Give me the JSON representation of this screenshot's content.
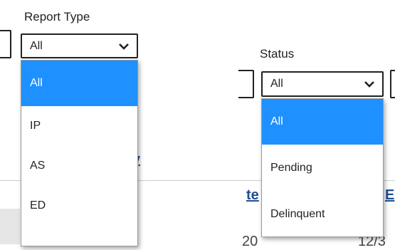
{
  "report_type": {
    "label": "Report Type",
    "selected": "All",
    "options": [
      "All",
      "IP",
      "AS",
      "ED"
    ]
  },
  "status": {
    "label": "Status",
    "selected": "All",
    "options": [
      "All",
      "Pending",
      "Delinquent"
    ]
  },
  "background": {
    "link_fragment_1": "y",
    "link_fragment_2": "te",
    "link_fragment_3": "E",
    "row_fragment_1": "20",
    "row_fragment_2": "12/3"
  },
  "colors": {
    "selected_option_bg": "#1e90ff",
    "link": "#1f4e96"
  },
  "icons": {
    "select_arrow": "chevron-down-icon"
  }
}
